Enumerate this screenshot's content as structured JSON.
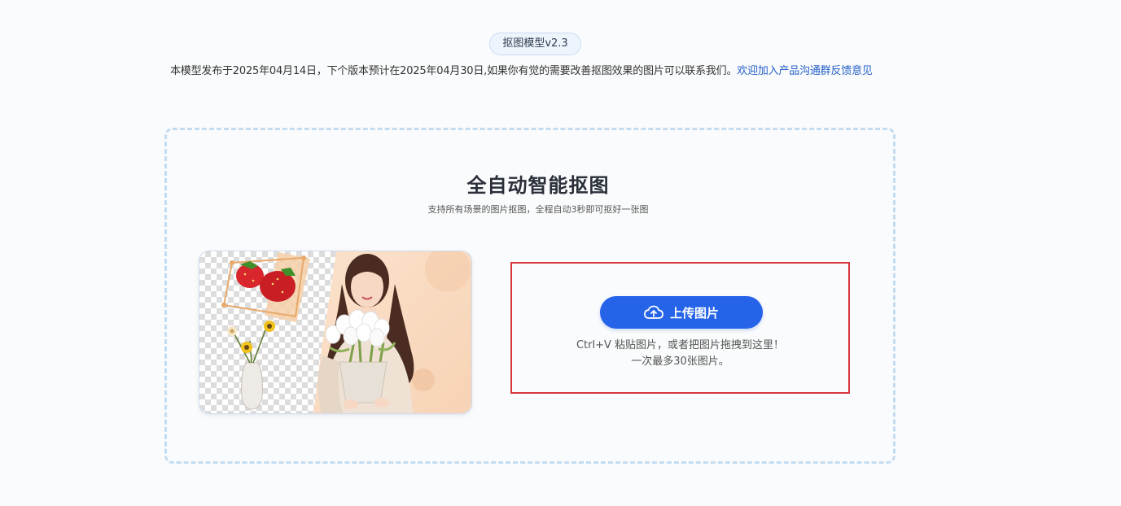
{
  "version_badge": "抠图模型v2.3",
  "notice": {
    "text": "本模型发布于2025年04月14日，下个版本预计在2025年04月30日,如果你有觉的需要改善抠图效果的图片可以联系我们。",
    "link": "欢迎加入产品沟通群反馈意见"
  },
  "hero": {
    "title": "全自动智能抠图",
    "subtitle": "支持所有场景的图片抠图，全程自动3秒即可抠好一张图"
  },
  "upload": {
    "button_label": "上传图片",
    "button_icon": "cloud-upload-icon",
    "hint_line1": "Ctrl+V 粘贴图片，或者把图片拖拽到这里！",
    "hint_line2": "一次最多30张图片。"
  },
  "colors": {
    "accent": "#2563e8",
    "link": "#2560c8",
    "dropzone_border": "#c3dcf1",
    "highlight_border": "#d9363e"
  }
}
